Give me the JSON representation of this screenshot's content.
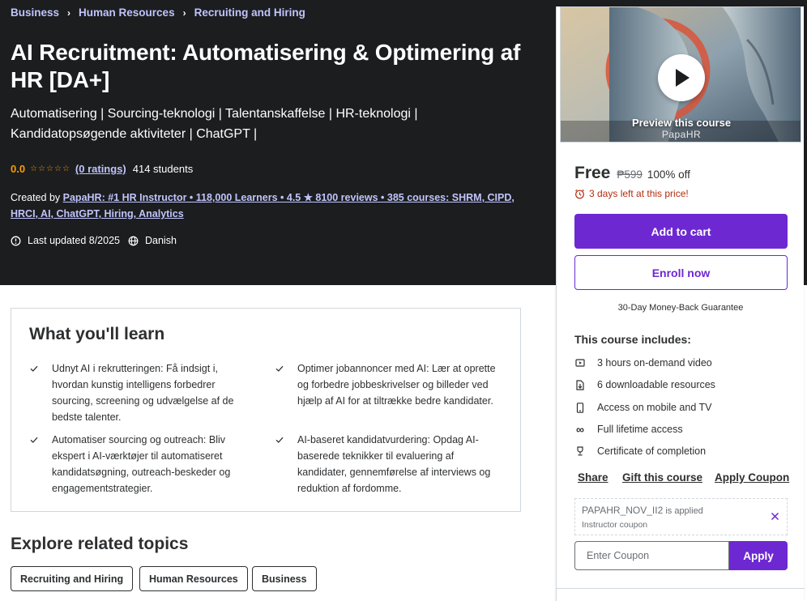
{
  "breadcrumb": {
    "items": [
      "Business",
      "Human Resources",
      "Recruiting and Hiring"
    ]
  },
  "course": {
    "title": "AI Recruitment: Automatisering & Optimering af HR [DA+]",
    "subtitle": "Automatisering | Sourcing-teknologi | Talentanskaffelse | HR-teknologi | Kandidatopsøgende aktiviteter | ChatGPT |",
    "rating": "0.0",
    "ratings_link": "(0 ratings)",
    "students": "414 students",
    "created_by_label": "Created by",
    "instructor": "PapaHR: #1 HR Instructor • 118,000 Learners • 4.5 ★ 8100 reviews • 385 courses: SHRM, CIPD, HRCI, AI, ChatGPT, Hiring, Analytics",
    "last_updated": "Last updated 8/2025",
    "language": "Danish"
  },
  "learn": {
    "title": "What you'll learn",
    "items": [
      "Udnyt AI i rekrutteringen: Få indsigt i, hvordan kunstig intelligens forbedrer sourcing, screening og udvælgelse af de bedste talenter.",
      "Optimer jobannoncer med AI: Lær at oprette og forbedre jobbeskrivelser og billeder ved hjælp af AI for at tiltrække bedre kandidater.",
      "Automatiser sourcing og outreach: Bliv ekspert i AI-værktøjer til automatiseret kandidatsøgning, outreach-beskeder og engagementstrategier.",
      "AI-baseret kandidatvurdering: Opdag AI-baserede teknikker til evaluering af kandidater, gennemførelse af interviews og reduktion af fordomme."
    ]
  },
  "explore": {
    "title": "Explore related topics",
    "topics": [
      "Recruiting and Hiring",
      "Human Resources",
      "Business"
    ]
  },
  "sidebar": {
    "preview_label": "Preview this course",
    "preview_brand": "PapaHR",
    "price_now": "Free",
    "price_old": "₱599",
    "price_off": "100% off",
    "timer_text": "3 days left at this price!",
    "add_to_cart": "Add to cart",
    "enroll_now": "Enroll now",
    "guarantee": "30-Day Money-Back Guarantee",
    "includes_title": "This course includes:",
    "includes": [
      {
        "icon": "video-icon",
        "text": "3 hours on-demand video"
      },
      {
        "icon": "download-file-icon",
        "text": "6 downloadable resources"
      },
      {
        "icon": "mobile-icon",
        "text": "Access on mobile and TV"
      },
      {
        "icon": "infinity-icon",
        "text": "Full lifetime access"
      },
      {
        "icon": "trophy-icon",
        "text": "Certificate of completion"
      }
    ],
    "share": "Share",
    "gift": "Gift this course",
    "apply_coupon": "Apply Coupon",
    "coupon_code": "PAPAHR_NOV_II2",
    "coupon_applied": " is applied",
    "coupon_sub": "Instructor coupon",
    "coupon_placeholder": "Enter Coupon",
    "apply_button": "Apply"
  },
  "colors": {
    "hero_bg": "#1c1d1f",
    "accent": "#6d28d2",
    "link_light": "#c0c4fc",
    "rating": "#f69c08",
    "timer_red": "#b32d0f"
  }
}
